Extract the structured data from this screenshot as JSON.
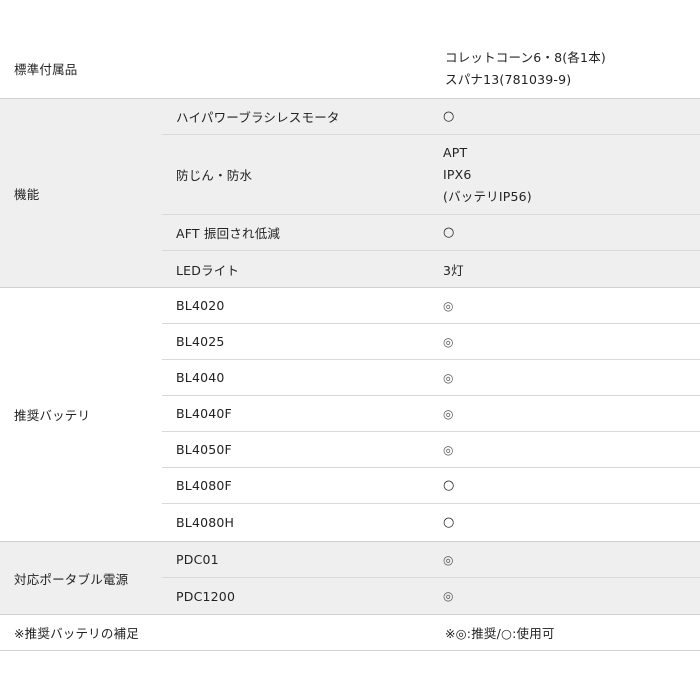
{
  "standard_accessories": {
    "label": "標準付属品",
    "values": [
      "コレットコーン6・8(各1本)",
      "スパナ13(781039-9)"
    ]
  },
  "functions": {
    "label": "機能",
    "items": [
      {
        "name": "ハイパワーブラシレスモータ",
        "values": [
          "○"
        ]
      },
      {
        "name": "防じん・防水",
        "values": [
          "APT",
          "IPX6",
          "(バッテリIP56)"
        ]
      },
      {
        "name": "AFT 振回され低減",
        "values": [
          "○"
        ]
      },
      {
        "name": "LEDライト",
        "values": [
          "3灯"
        ]
      }
    ]
  },
  "recommended_batteries": {
    "label": "推奨バッテリ",
    "items": [
      {
        "name": "BL4020",
        "value": "◎"
      },
      {
        "name": "BL4025",
        "value": "◎"
      },
      {
        "name": "BL4040",
        "value": "◎"
      },
      {
        "name": "BL4040F",
        "value": "◎"
      },
      {
        "name": "BL4050F",
        "value": "◎"
      },
      {
        "name": "BL4080F",
        "value": "○"
      },
      {
        "name": "BL4080H",
        "value": "○"
      }
    ]
  },
  "portable_power": {
    "label": "対応ポータブル電源",
    "items": [
      {
        "name": "PDC01",
        "value": "◎"
      },
      {
        "name": "PDC1200",
        "value": "◎"
      }
    ]
  },
  "battery_note": {
    "label": "※推奨バッテリの補足",
    "value": "※◎:推奨/○:使用可"
  }
}
